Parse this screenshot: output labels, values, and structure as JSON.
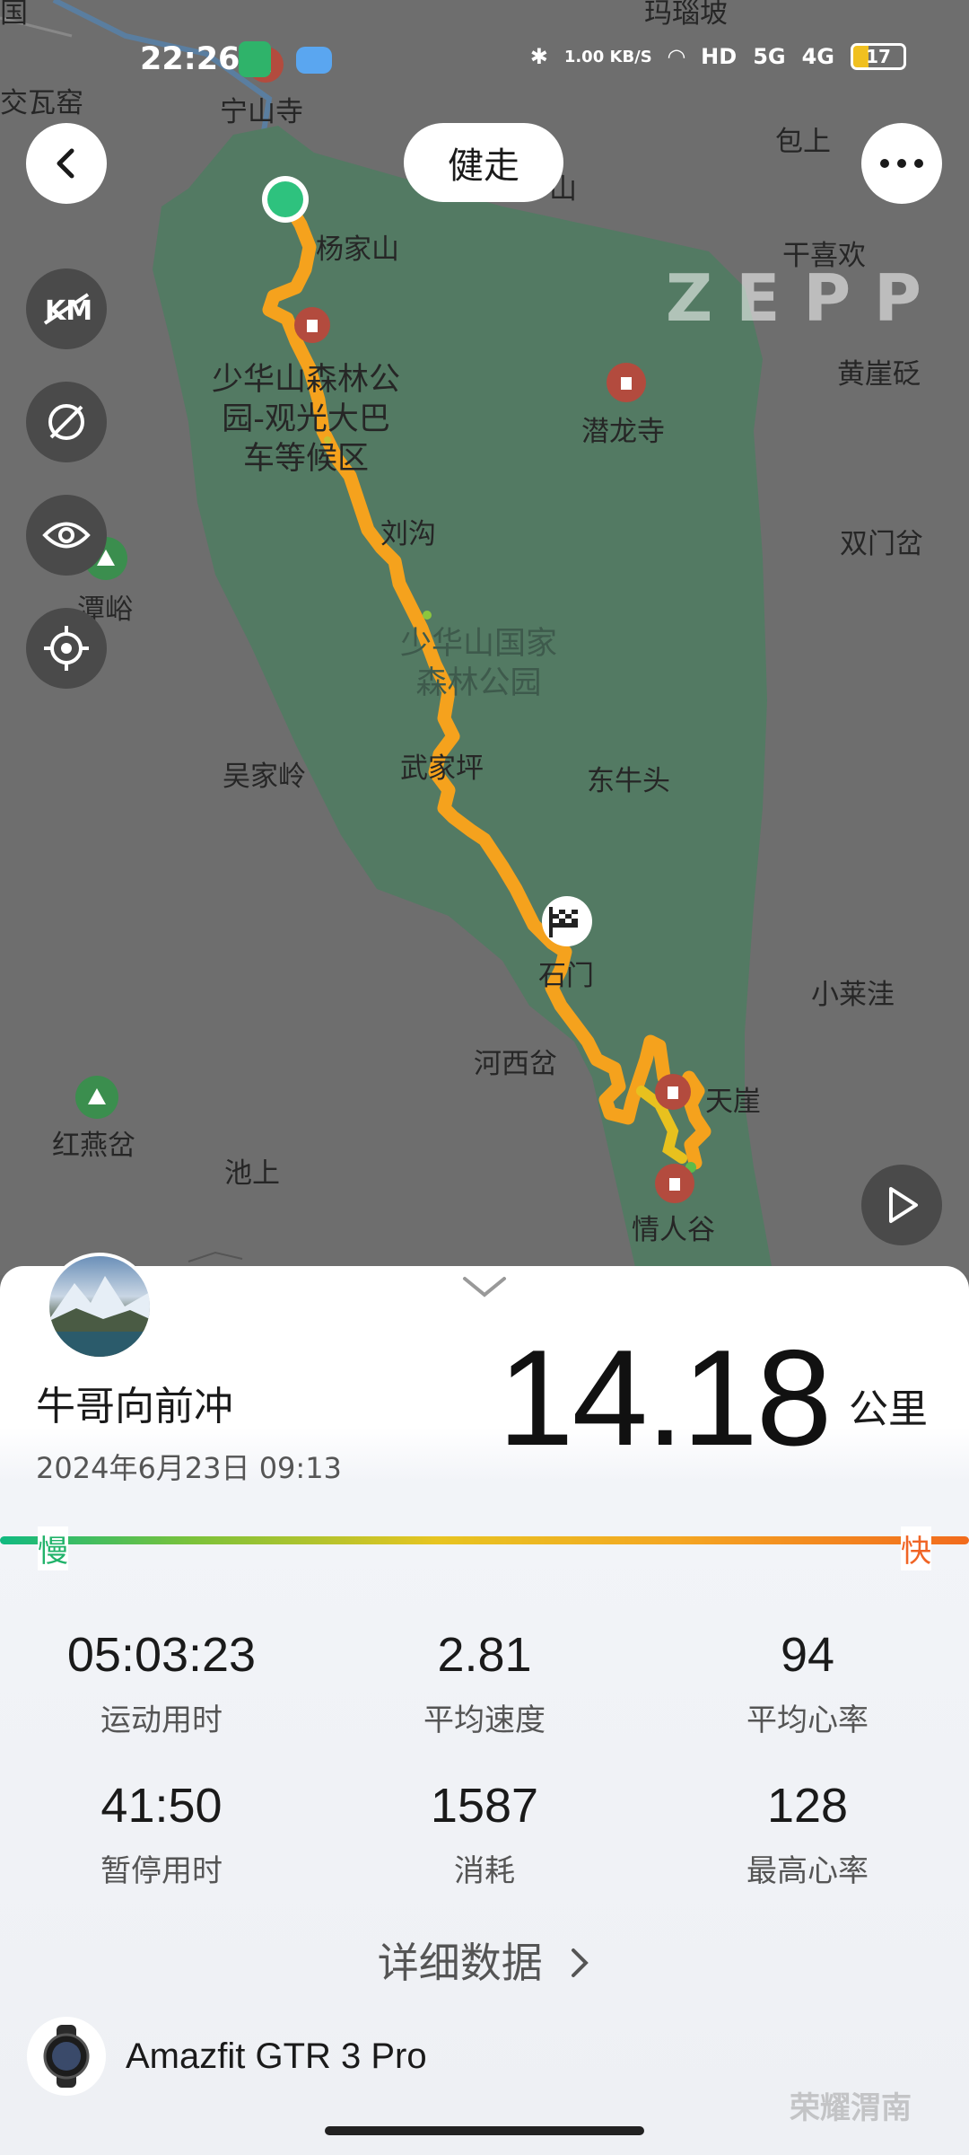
{
  "status_bar": {
    "time": "22:26",
    "net_speed": "1.00 KB/S",
    "signal_1": "5G",
    "signal_2": "4G",
    "hd": "HD",
    "battery": "17"
  },
  "map": {
    "labels": {
      "guo": "国",
      "yaolapo": "玛瑙坡",
      "jiaowagu": "交瓦窑",
      "ningshansi": "宁山寺",
      "baoshang": "包上",
      "shan": "山",
      "yangjiashan": "杨家山",
      "ganxihuan": "干喜欢",
      "huangyaling": "黄崖砭",
      "shaohua_scenic": "少华山森林公\n园-观光大巴\n车等候区",
      "qianlongsi": "潜龙寺",
      "liugou": "刘沟",
      "shuangmencha": "双门岔",
      "tanyu": "潭峪",
      "shaohua_park": "少华山国家\n森林公园",
      "wujialing": "吴家岭",
      "wuguanping": "武家坪",
      "dongniutou": "东牛头",
      "shimen": "石门",
      "xiaolaiwa": "小莱洼",
      "hexicha": "河西岔",
      "tianya": "天崖",
      "hongyancha": "红燕岔",
      "chishang": "池上",
      "qingrengu": "情人谷"
    },
    "sport_mode": "健走",
    "brand_logo": "ZEPP"
  },
  "controls": {
    "back": "back-icon",
    "more": "more-icon",
    "km": "km-icon",
    "hide": "hide-icon",
    "eye": "eye-icon",
    "locate": "locate-icon",
    "play": "play-icon"
  },
  "summary": {
    "username": "牛哥向前冲",
    "datetime": "2024年6月23日 09:13",
    "distance": "14.18",
    "distance_unit": "公里",
    "slow_label": "慢",
    "fast_label": "快"
  },
  "stats": [
    {
      "value": "05:03:23",
      "label": "运动用时"
    },
    {
      "value": "2.81",
      "label": "平均速度"
    },
    {
      "value": "94",
      "label": "平均心率"
    },
    {
      "value": "41:50",
      "label": "暂停用时"
    },
    {
      "value": "1587",
      "label": "消耗"
    },
    {
      "value": "128",
      "label": "最高心率"
    }
  ],
  "detail_link": "详细数据",
  "device": {
    "name": "Amazfit GTR 3 Pro"
  },
  "watermark": "荣耀渭南",
  "colors": {
    "park": "#547a64",
    "route": "#f5a21d",
    "start": "#2ec27e"
  }
}
